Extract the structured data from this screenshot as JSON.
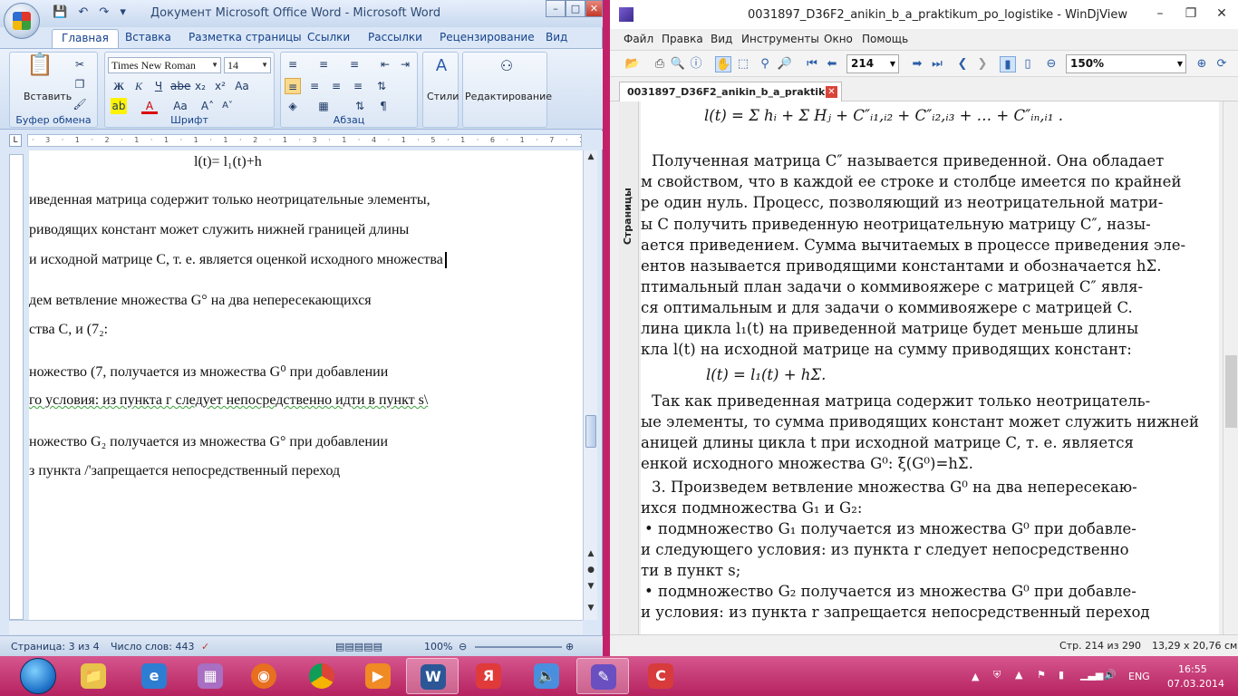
{
  "word": {
    "title": "Документ Microsoft Office Word - Microsoft Word",
    "tabs": [
      "Главная",
      "Вставка",
      "Разметка страницы",
      "Ссылки",
      "Рассылки",
      "Рецензирование",
      "Вид"
    ],
    "ribbon": {
      "paste": "Вставить",
      "clipboard_group": "Буфер обмена",
      "font_name": "Times New Roman",
      "font_size": "14",
      "font_group": "Шрифт",
      "para_group": "Абзац",
      "styles": "Стили",
      "editing": "Редактирование"
    },
    "doc_lines": [
      "l(t)= l₁(t)+h",
      "иведенная матрица содержит только неотрицательные элементы,",
      "риводящих констант может служить нижней границей длины",
      "и исходной матрице С, т. е. является оценкой исходного множества",
      "дем ветвление множества G° на два непересекающихся",
      "ства С, и (7₂:",
      "ножество (7, получается из множества G⁰ при добавлении",
      "го условия: из пункта г следует непосредственно идти в пункт s\\",
      "ножество G₂ получается из множества G° при добавлении",
      "з пункта /'запрещается непосредственный переход"
    ],
    "status": {
      "page": "Страница: 3 из 4",
      "words": "Число слов: 443",
      "zoom": "100%"
    }
  },
  "djview": {
    "title": "0031897_D36F2_anikin_b_a_praktikum_po_logistike - WinDjView",
    "menu": [
      "Файл",
      "Правка",
      "Вид",
      "Инструменты",
      "Окно",
      "Помощь"
    ],
    "page_number": "214",
    "zoom": "150%",
    "tab_title": "0031897_D36F2_anikin_b_a_praktik...",
    "side_label": "Страницы",
    "page_lines": [
      "l(t) = Σ hᵢ + Σ Hⱼ + C″ᵢ₁,ᵢ₂ + C″ᵢ₂,ᵢ₃ + … + C″ᵢₙ,ᵢ₁ .",
      "Полученная матрица C″ называется приведенной. Она обладает",
      "м свойством, что в каждой ее строке и столбце имеется по крайней",
      "ре один нуль. Процесс, позволяющий из неотрицательной матри-",
      "ы C получить приведенную неотрицательную матрицу C″, назы-",
      "ается приведением. Сумма вычитаемых в процессе приведения эле-",
      "ентов называется приводящими константами и обозначается hΣ.",
      "птимальный план задачи о коммивояжере с матрицей C″ явля-",
      "ся оптимальным и для задачи о коммивояжере с матрицей C.",
      "лина цикла l₁(t) на приведенной матрице будет меньше длины",
      "кла l(t) на исходной матрице на сумму приводящих констант:",
      "l(t) =  l₁(t) +  hΣ.",
      "Так как приведенная матрица содержит только неотрицатель-",
      "ые элементы, то сумма приводящих констант может служить нижней",
      "аницей длины цикла t при исходной матрице C, т. е. является",
      "енкой исходного множества G⁰: ξ(G⁰)=hΣ.",
      "3. Произведем ветвление множества G⁰ на два непересекаю-",
      "ихся подмножества G₁ и G₂:",
      "• подмножество G₁ получается из множества G⁰ при добавле-",
      "и следующего условия: из пункта r следует непосредственно",
      "ти в пункт s;",
      "• подмножество G₂ получается из множества G⁰ при добавле-",
      "и условия: из пункта r запрещается непосредственный переход"
    ],
    "status": {
      "page": "Стр. 214 из 290",
      "size": "13,29 x 20,76 см"
    }
  },
  "taskbar": {
    "lang": "ENG",
    "time": "16:55",
    "date": "07.03.2014"
  },
  "colors": {
    "desktop": "#c2216a",
    "word_chrome": "#dbe7f6",
    "taskbar": "#c0306c"
  }
}
